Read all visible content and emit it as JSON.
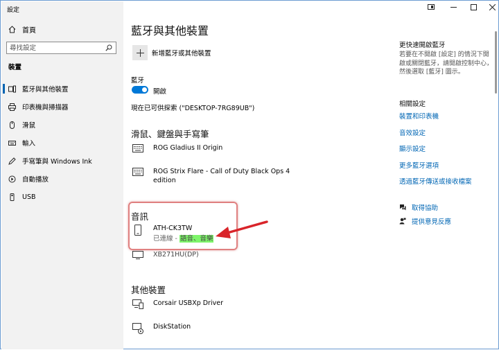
{
  "window": {
    "title": "設定"
  },
  "sidebar": {
    "home_label": "首頁",
    "search_placeholder": "尋找設定",
    "section_label": "裝置",
    "items": [
      {
        "label": "藍牙與其他裝置",
        "icon": "bluetooth-devices-icon",
        "selected": true
      },
      {
        "label": "印表機與掃描器",
        "icon": "printer-icon"
      },
      {
        "label": "滑鼠",
        "icon": "mouse-icon"
      },
      {
        "label": "輸入",
        "icon": "keyboard-icon"
      },
      {
        "label": "手寫筆與 Windows Ink",
        "icon": "pen-icon"
      },
      {
        "label": "自動播放",
        "icon": "autoplay-icon"
      },
      {
        "label": "USB",
        "icon": "usb-icon"
      }
    ]
  },
  "main": {
    "title": "藍牙與其他裝置",
    "add_device_label": "新增藍牙或其他裝置",
    "bluetooth_label": "藍牙",
    "toggle_label": "開啟",
    "toggle_on": true,
    "discoverable_text": "現在已可供探索 (\"DESKTOP-7RG89UB\")",
    "mouse_section": {
      "heading": "滑鼠、鍵盤與手寫筆",
      "devices": [
        {
          "name": "ROG Gladius II Origin",
          "icon": "keyboard-icon"
        },
        {
          "name_line1": "ROG Strix Flare - Call of Duty Black Ops 4",
          "name_line2": "edition",
          "icon": "keyboard-icon"
        }
      ]
    },
    "audio_section": {
      "heading": "音訊",
      "device_name": "ATH-CK3TW",
      "status_prefix": "已連線 - ",
      "status_highlight": "語音、音樂",
      "icon": "phone-device-icon"
    },
    "partial_device": {
      "name": "XB271HU(DP)",
      "icon": "monitor-icon"
    },
    "other_section": {
      "heading": "其他裝置",
      "devices": [
        {
          "name": "Corsair USBXp Driver",
          "icon": "device-icon"
        },
        {
          "name": "DiskStation",
          "icon": "media-device-icon"
        }
      ]
    }
  },
  "right_panel": {
    "quick_heading": "更快速開啟藍牙",
    "quick_desc": "若要在不開啟 [設定] 的情況下開啟或關閉藍牙，請開啟控制中心，然後選取 [藍牙] 圖示。",
    "related_heading": "相關設定",
    "links": [
      "裝置和印表機",
      "音效設定",
      "顯示設定",
      "更多藍牙選項",
      "透過藍牙傳送或接收檔案"
    ],
    "help_label": "取得協助",
    "feedback_label": "提供意見反應"
  },
  "colors": {
    "accent": "#0078d7",
    "link": "#0066b4",
    "highlight": "#7ef56a",
    "annotation": "#d9242a"
  }
}
